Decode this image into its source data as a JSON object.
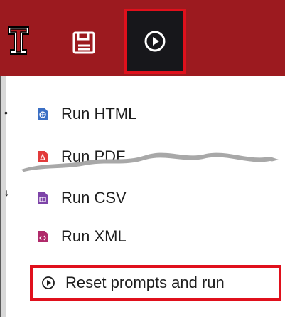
{
  "toolbar": {
    "logo_icon": "university-logo-icon",
    "save_icon": "save-icon",
    "run_icon": "play-circle-icon",
    "accent_color": "#9c1a1f",
    "highlight_color": "#e0101c"
  },
  "menu": {
    "items": [
      {
        "label": "Run HTML",
        "icon": "html-file-icon",
        "color": "#3b6fc4"
      },
      {
        "label": "Run PDF",
        "icon": "pdf-file-icon",
        "color": "#e23b3b"
      },
      {
        "label": "Run CSV",
        "icon": "csv-file-icon",
        "color": "#7d44a8"
      },
      {
        "label": "Run XML",
        "icon": "xml-file-icon",
        "color": "#b02a6a"
      },
      {
        "label": "Reset prompts and run",
        "icon": "play-circle-icon",
        "color": "#1e1e1e"
      }
    ]
  }
}
